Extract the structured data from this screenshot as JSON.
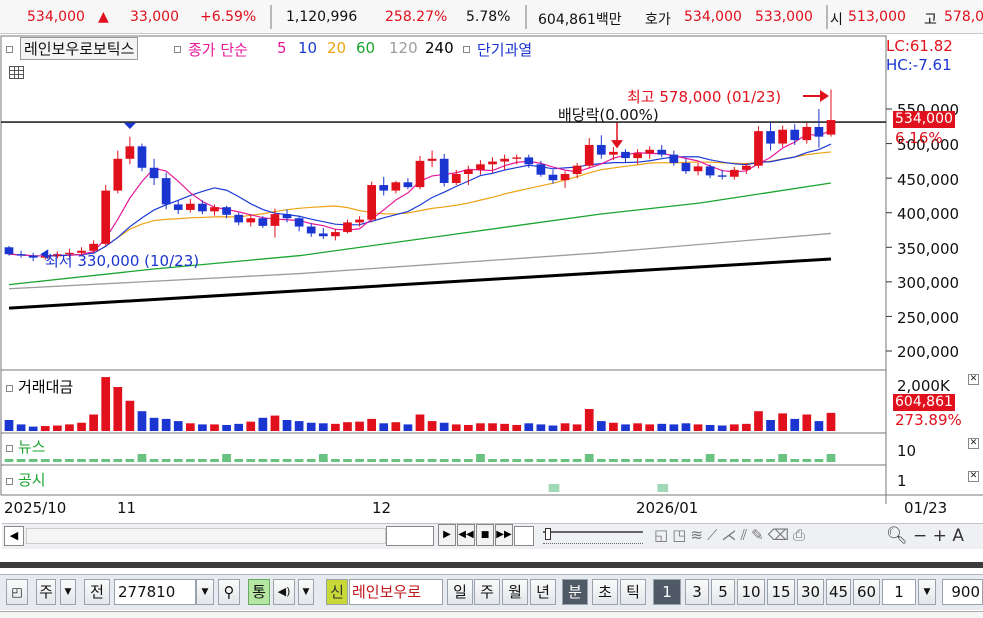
{
  "ticker": {
    "price": "534,000",
    "change_arrow": "▲",
    "change": "33,000",
    "change_pct": "+6.59%",
    "volume": "1,120,996",
    "volume_pct": "258.27%",
    "turnover": "5.78%",
    "amount": "604,861백만",
    "quote_label": "호가",
    "ask": "534,000",
    "bid": "533,000",
    "open_label": "시",
    "open": "513,000",
    "high_label": "고",
    "high": "578,0"
  },
  "legend": {
    "stock": "레인보우로보틱스",
    "ma_label": "종가 단순",
    "ma_periods": [
      "5",
      "10",
      "20",
      "60",
      "120",
      "240"
    ],
    "indicator": "단기과열",
    "ma_colors": [
      "#e8199b",
      "#1c3bd6",
      "#eea214",
      "#1aa52f",
      "#9c9c9c",
      "#000000"
    ]
  },
  "right_info": {
    "lc": "LC:61.82",
    "hc": "HC:-7.61"
  },
  "annotations": {
    "high": "최고 578,000 (01/23)",
    "low": "최저 330,000 (10/23)",
    "dividend": "배당락(0.00%)"
  },
  "price_axis": [
    "550,000",
    "500,000",
    "450,000",
    "400,000",
    "350,000",
    "300,000",
    "250,000",
    "200,000"
  ],
  "price_tag": "534,000",
  "price_tag_pct": "6.16%",
  "volume_pane": {
    "label": "거래대금",
    "axis": "2,000K",
    "tag": "604,861",
    "tag_pct": "273.89%"
  },
  "news_pane": {
    "label": "뉴스",
    "axis": "10"
  },
  "disclosure_pane": {
    "label": "공시",
    "axis": "1"
  },
  "time_axis": [
    "2025/10",
    "11",
    "12",
    "2026/01",
    "01/23"
  ],
  "toolbar": {
    "type1": "주",
    "type2": "전",
    "code": "277810",
    "tong": "통",
    "sin": "신",
    "name": "레인보우로",
    "periods": [
      "일",
      "주",
      "월",
      "년",
      "분",
      "초",
      "틱"
    ],
    "selected_period": "분",
    "intervals": [
      "1",
      "3",
      "5",
      "10",
      "15",
      "30",
      "45",
      "60"
    ],
    "selected_interval": "1",
    "count": "1",
    "count2": "900"
  },
  "chart_data": {
    "type": "candlestick",
    "title": "레인보우로보틱스",
    "ylim": [
      185000,
      600000
    ],
    "candles": [
      [
        350000,
        352000,
        338000,
        340000
      ],
      [
        340000,
        345000,
        335000,
        338000
      ],
      [
        338000,
        342000,
        330000,
        335000
      ],
      [
        335000,
        341000,
        332000,
        337000
      ],
      [
        337000,
        344000,
        334000,
        340000
      ],
      [
        340000,
        348000,
        335000,
        342000
      ],
      [
        342000,
        350000,
        338000,
        345000
      ],
      [
        345000,
        360000,
        342000,
        355000
      ],
      [
        355000,
        440000,
        352000,
        432000
      ],
      [
        432000,
        490000,
        428000,
        478000
      ],
      [
        478000,
        510000,
        470000,
        496000
      ],
      [
        496000,
        500000,
        460000,
        465000
      ],
      [
        465000,
        478000,
        440000,
        450000
      ],
      [
        450000,
        458000,
        405000,
        412000
      ],
      [
        412000,
        418000,
        398000,
        404000
      ],
      [
        404000,
        420000,
        400000,
        413000
      ],
      [
        413000,
        418000,
        398000,
        402000
      ],
      [
        402000,
        412000,
        396000,
        408000
      ],
      [
        408000,
        410000,
        392000,
        397000
      ],
      [
        397000,
        400000,
        382000,
        386000
      ],
      [
        386000,
        398000,
        380000,
        392000
      ],
      [
        392000,
        395000,
        378000,
        381000
      ],
      [
        381000,
        406000,
        364000,
        398000
      ],
      [
        398000,
        405000,
        386000,
        392000
      ],
      [
        392000,
        396000,
        373000,
        380000
      ],
      [
        380000,
        385000,
        365000,
        370000
      ],
      [
        370000,
        378000,
        362000,
        366000
      ],
      [
        366000,
        377000,
        360000,
        372000
      ],
      [
        372000,
        390000,
        370000,
        386000
      ],
      [
        386000,
        395000,
        380000,
        390000
      ],
      [
        390000,
        445000,
        386000,
        440000
      ],
      [
        440000,
        452000,
        425000,
        432000
      ],
      [
        432000,
        446000,
        428000,
        444000
      ],
      [
        444000,
        450000,
        434000,
        437000
      ],
      [
        437000,
        482000,
        434000,
        475000
      ],
      [
        475000,
        490000,
        466000,
        478000
      ],
      [
        478000,
        485000,
        438000,
        443000
      ],
      [
        443000,
        462000,
        440000,
        456000
      ],
      [
        456000,
        468000,
        440000,
        462000
      ],
      [
        462000,
        476000,
        455000,
        470000
      ],
      [
        470000,
        480000,
        458000,
        474000
      ],
      [
        474000,
        484000,
        462000,
        478000
      ],
      [
        478000,
        484000,
        470000,
        480000
      ],
      [
        480000,
        484000,
        465000,
        470000
      ],
      [
        470000,
        475000,
        452000,
        455000
      ],
      [
        455000,
        462000,
        442000,
        447000
      ],
      [
        447000,
        460000,
        436000,
        456000
      ],
      [
        456000,
        472000,
        450000,
        468000
      ],
      [
        468000,
        508000,
        465000,
        498000
      ],
      [
        498000,
        512000,
        478000,
        484000
      ],
      [
        484000,
        495000,
        476000,
        488000
      ],
      [
        488000,
        492000,
        472000,
        479000
      ],
      [
        479000,
        492000,
        470000,
        486000
      ],
      [
        486000,
        496000,
        478000,
        491000
      ],
      [
        491000,
        498000,
        480000,
        484000
      ],
      [
        484000,
        490000,
        468000,
        472000
      ],
      [
        472000,
        478000,
        456000,
        460000
      ],
      [
        460000,
        472000,
        454000,
        467000
      ],
      [
        467000,
        470000,
        450000,
        454000
      ],
      [
        454000,
        462000,
        448000,
        452000
      ],
      [
        452000,
        466000,
        448000,
        462000
      ],
      [
        462000,
        472000,
        456000,
        468000
      ],
      [
        468000,
        525000,
        464000,
        518000
      ],
      [
        518000,
        530000,
        490000,
        500000
      ],
      [
        500000,
        526000,
        495000,
        520000
      ],
      [
        520000,
        528000,
        498000,
        505000
      ],
      [
        505000,
        530000,
        500000,
        524000
      ],
      [
        524000,
        550000,
        494000,
        510000
      ],
      [
        513000,
        578000,
        510000,
        534000
      ]
    ],
    "volume": [
      20,
      12,
      8,
      9,
      10,
      12,
      15,
      30,
      98,
      80,
      55,
      36,
      24,
      22,
      18,
      14,
      12,
      12,
      11,
      13,
      17,
      24,
      28,
      20,
      18,
      15,
      14,
      13,
      16,
      17,
      22,
      14,
      16,
      12,
      30,
      18,
      15,
      12,
      11,
      14,
      14,
      13,
      11,
      14,
      12,
      10,
      14,
      12,
      40,
      18,
      15,
      12,
      14,
      12,
      13,
      12,
      14,
      12,
      11,
      10,
      12,
      13,
      36,
      20,
      32,
      22,
      30,
      18,
      33
    ],
    "series": [
      {
        "name": "5"
      },
      {
        "name": "10"
      },
      {
        "name": "20"
      },
      {
        "name": "60"
      },
      {
        "name": "120"
      },
      {
        "name": "240"
      }
    ]
  }
}
